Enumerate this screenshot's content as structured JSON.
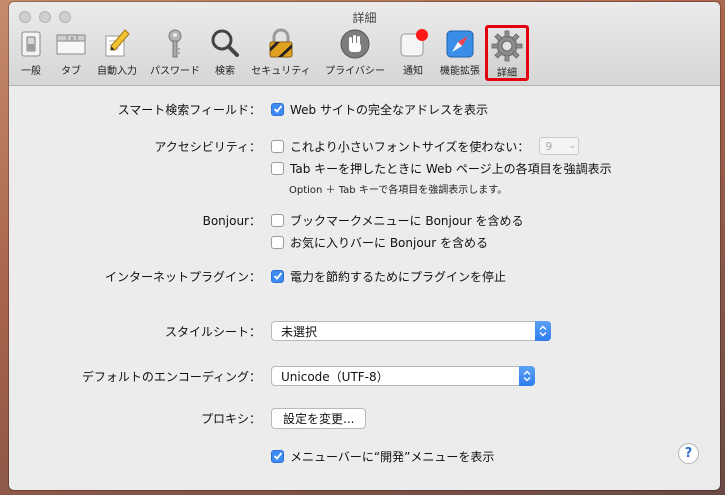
{
  "window": {
    "title": "詳細"
  },
  "toolbar": {
    "items": [
      {
        "label": "一般",
        "icon": "general-switch-icon"
      },
      {
        "label": "タブ",
        "icon": "tabs-icon"
      },
      {
        "label": "自動入力",
        "icon": "autofill-pencil-icon"
      },
      {
        "label": "パスワード",
        "icon": "key-icon"
      },
      {
        "label": "検索",
        "icon": "magnifier-icon"
      },
      {
        "label": "セキュリティ",
        "icon": "padlock-icon"
      },
      {
        "label": "プライバシー",
        "icon": "hand-icon"
      },
      {
        "label": "通知",
        "icon": "notification-badge-icon"
      },
      {
        "label": "機能拡張",
        "icon": "extensions-compass-icon"
      },
      {
        "label": "詳細",
        "icon": "gear-icon",
        "selected": true
      }
    ]
  },
  "smart_search": {
    "label": "スマート検索フィールド：",
    "option": "Web サイトの完全なアドレスを表示",
    "checked": true
  },
  "accessibility": {
    "label": "アクセシビリティ：",
    "min_font_option": "これより小さいフォントサイズを使わない：",
    "min_font_checked": false,
    "min_font_value": "9",
    "tab_option": "Tab キーを押したときに Web ページ上の各項目を強調表示",
    "tab_checked": false,
    "tab_note": "Option ＋ Tab キーで各項目を強調表示します。"
  },
  "bonjour": {
    "label": "Bonjour：",
    "bookmarks_option": "ブックマークメニューに Bonjour を含める",
    "bookmarks_checked": false,
    "favorites_option": "お気に入りバーに Bonjour を含める",
    "favorites_checked": false
  },
  "plugins": {
    "label": "インターネットプラグイン：",
    "option": "電力を節約するためにプラグインを停止",
    "checked": true
  },
  "stylesheet": {
    "label": "スタイルシート：",
    "value": "未選択"
  },
  "encoding": {
    "label": "デフォルトのエンコーディング：",
    "value": "Unicode（UTF-8）"
  },
  "proxy": {
    "label": "プロキシ：",
    "button": "設定を変更..."
  },
  "develop_menu": {
    "option": "メニューバーに“開発”メニューを表示",
    "checked": true
  },
  "help": {
    "glyph": "?"
  },
  "colors": {
    "accent": "#3d8bf3",
    "selection_outline": "#e0000e"
  }
}
